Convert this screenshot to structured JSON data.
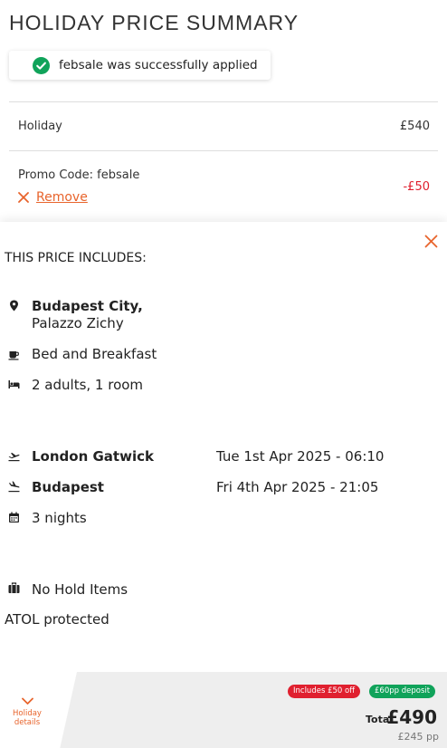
{
  "summary": {
    "title": "HOLIDAY PRICE SUMMARY",
    "promo_message": "febsale was successfully applied"
  },
  "price_rows": {
    "holiday_label": "Holiday",
    "holiday_value": "£540",
    "promo_label": "Promo Code: febsale",
    "promo_value": "-£50",
    "remove_label": "Remove"
  },
  "includes": {
    "heading": "THIS PRICE INCLUDES:",
    "hotel_city": "Budapest City,",
    "hotel_name": "Palazzo Zichy",
    "board": "Bed and Breakfast",
    "occupancy": "2 adults, 1 room",
    "outbound_airport": "London Gatwick",
    "outbound_date": "Tue 1st Apr 2025 - 06:10",
    "return_airport": "Budapest",
    "return_date": "Fri 4th Apr 2025 - 21:05",
    "nights": "3 nights",
    "hold_items": "No Hold Items",
    "atol": "ATOL protected"
  },
  "footer": {
    "toggle_label": "Holiday details",
    "discount_badge": "Includes £50 off",
    "deposit_badge": "£60pp deposit",
    "total_label": "Total",
    "total_value": "£490",
    "per_person": "£245 pp"
  },
  "colors": {
    "accent": "#e8642c",
    "discount": "#e0202f",
    "success": "#10a35a"
  },
  "icons": {
    "toast": "check-circle-icon",
    "remove": "close-icon",
    "panel_close": "close-icon",
    "hotel": "map-pin-icon",
    "board": "coffee-cup-icon",
    "occupancy": "bed-icon",
    "outbound": "plane-takeoff-icon",
    "return": "plane-landing-icon",
    "nights": "calendar-icon",
    "hold_items": "luggage-icon",
    "toggle": "chevron-down-icon"
  }
}
